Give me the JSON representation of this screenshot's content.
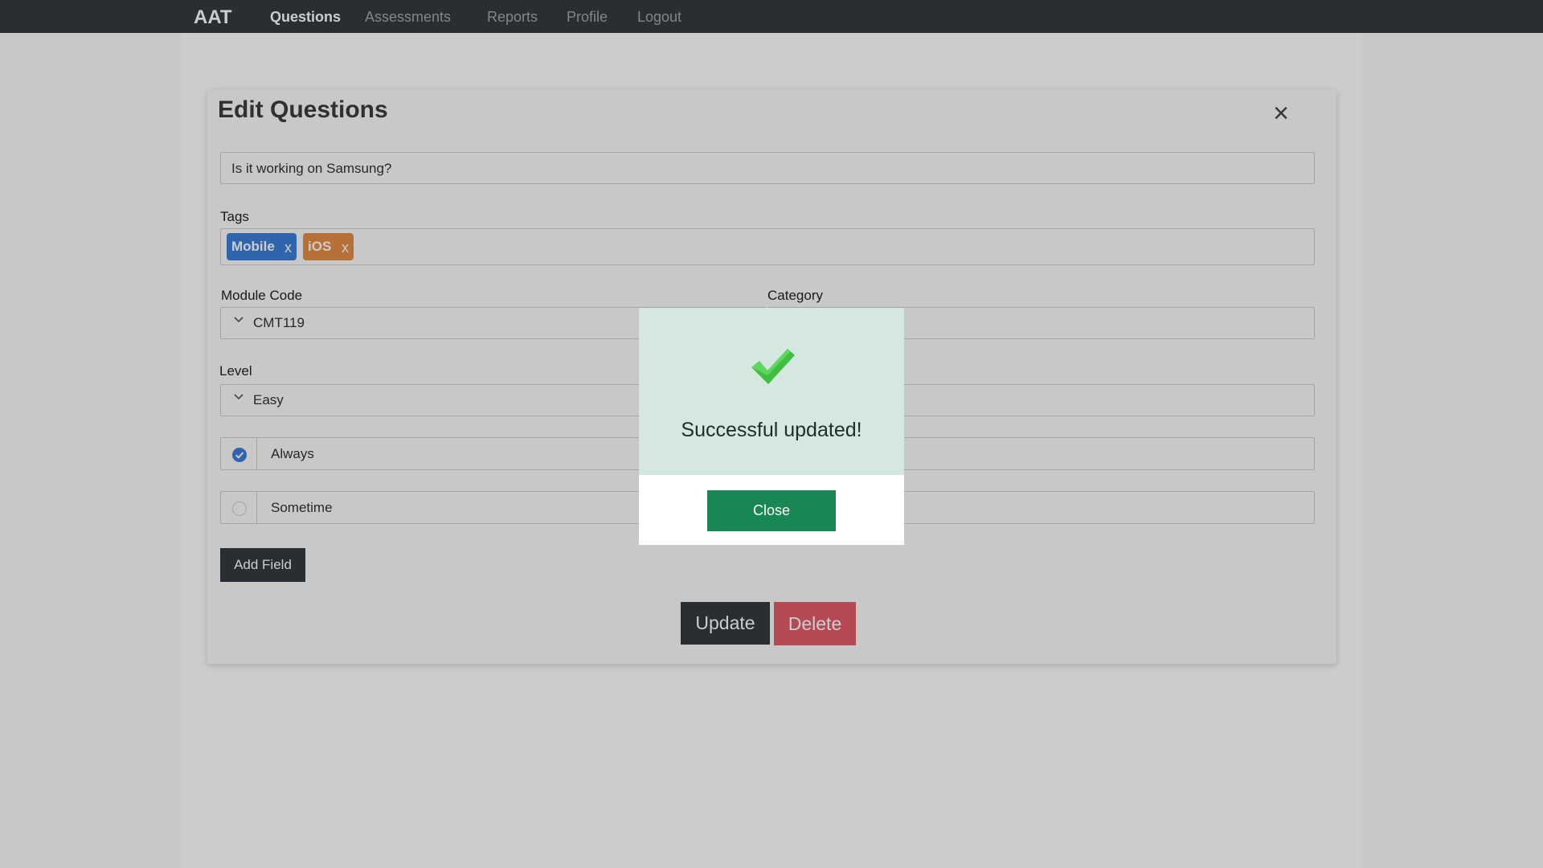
{
  "navbar": {
    "brand": "AAT",
    "items": [
      {
        "label": "Questions",
        "active": true
      },
      {
        "label": "Assessments",
        "active": false
      },
      {
        "label": "Reports",
        "active": false
      },
      {
        "label": "Profile",
        "active": false
      },
      {
        "label": "Logout",
        "active": false
      }
    ]
  },
  "edit_dialog": {
    "title": "Edit Questions",
    "close_icon": "close-icon",
    "question_value": "Is it working on Samsung?",
    "tags_label": "Tags",
    "tags": [
      {
        "label": "Mobile",
        "remove": "x",
        "color": "#3d7fd9"
      },
      {
        "label": "iOS",
        "remove": "x",
        "color": "#e58d45"
      }
    ],
    "module_code_label": "Module Code",
    "module_code_value": "CMT119",
    "category_label": "Category",
    "level_label": "Level",
    "level_value": "Easy",
    "choices": [
      {
        "label": "Always",
        "selected": true
      },
      {
        "label": "Sometime",
        "selected": false
      }
    ],
    "add_field_label": "Add Field",
    "update_label": "Update",
    "delete_label": "Delete"
  },
  "success_popup": {
    "message": "Successful updated!",
    "close_label": "Close",
    "icon": "checkmark-icon",
    "colors": {
      "top": "#d4e8df",
      "button": "#198754",
      "check": "#3fbf3f"
    }
  }
}
